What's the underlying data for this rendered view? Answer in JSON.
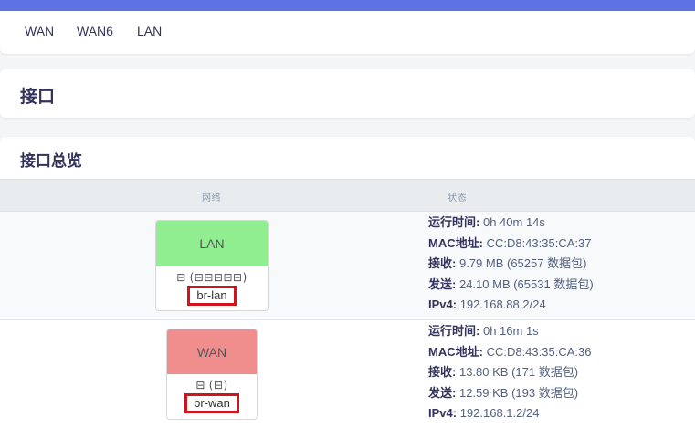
{
  "tabs": [
    {
      "label": "WAN"
    },
    {
      "label": "WAN6"
    },
    {
      "label": "LAN"
    }
  ],
  "page_title": "接口",
  "overview": {
    "title": "接口总览",
    "columns": {
      "network": "网络",
      "status": "状态"
    },
    "interfaces": [
      {
        "name": "LAN",
        "header_color": "#90ee90",
        "devices": "(🔌🔌🔌🔌🔌)",
        "device_name": "br-lan",
        "status": {
          "uptime_label": "运行时间:",
          "uptime": "0h 40m 14s",
          "mac_label": "MAC地址:",
          "mac": "CC:D8:43:35:CA:37",
          "rx_label": "接收:",
          "rx": "9.79 MB (65257 数据包)",
          "tx_label": "发送:",
          "tx": "24.10 MB (65531 数据包)",
          "ipv4_label": "IPv4:",
          "ipv4": "192.168.88.2/24"
        }
      },
      {
        "name": "WAN",
        "header_color": "#f08e8e",
        "devices": "(🔌)",
        "device_name": "br-wan",
        "status": {
          "uptime_label": "运行时间:",
          "uptime": "0h 16m 1s",
          "mac_label": "MAC地址:",
          "mac": "CC:D8:43:35:CA:36",
          "rx_label": "接收:",
          "rx": "13.80 KB (171 数据包)",
          "tx_label": "发送:",
          "tx": "12.59 KB (193 数据包)",
          "ipv4_label": "IPv4:",
          "ipv4": "192.168.1.2/24"
        }
      }
    ]
  },
  "colors": {
    "accent": "#5e72e4",
    "highlight_box": "#d0141b"
  }
}
